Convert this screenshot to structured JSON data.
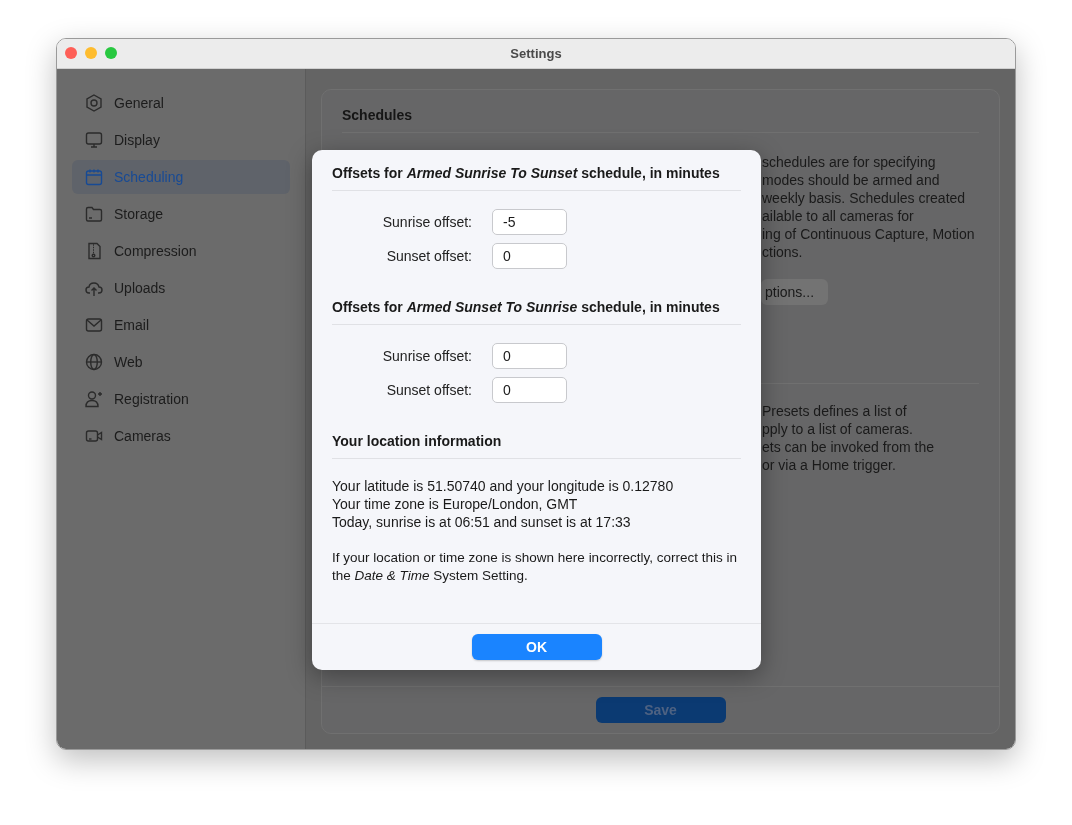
{
  "window": {
    "title": "Settings"
  },
  "sidebar": {
    "items": [
      {
        "label": "General",
        "selected": false
      },
      {
        "label": "Display",
        "selected": false
      },
      {
        "label": "Scheduling",
        "selected": true
      },
      {
        "label": "Storage",
        "selected": false
      },
      {
        "label": "Compression",
        "selected": false
      },
      {
        "label": "Uploads",
        "selected": false
      },
      {
        "label": "Email",
        "selected": false
      },
      {
        "label": "Web",
        "selected": false
      },
      {
        "label": "Registration",
        "selected": false
      },
      {
        "label": "Cameras",
        "selected": false
      }
    ]
  },
  "panel": {
    "title": "Schedules",
    "sections": [
      {
        "lines": [
          "schedules are for specifying",
          "modes should be armed and",
          "weekly basis. Schedules created",
          "ailable to all cameras for",
          "ing of Continuous Capture, Motion",
          "ctions."
        ],
        "button": "ptions..."
      },
      {
        "lines": [
          "Presets defines a list of",
          "pply to a list of cameras.",
          "ets can be invoked from the",
          "or via a Home trigger."
        ]
      }
    ],
    "save_button": "Save"
  },
  "dialog": {
    "groups": [
      {
        "heading": "Offsets for *Armed Sunrise To Sunset* schedule, in minutes",
        "fields": [
          {
            "label": "Sunrise offset:",
            "value": "-5"
          },
          {
            "label": "Sunset offset:",
            "value": "0"
          }
        ]
      },
      {
        "heading": "Offsets for *Armed Sunset To Sunrise* schedule, in minutes",
        "fields": [
          {
            "label": "Sunrise offset:",
            "value": "0"
          },
          {
            "label": "Sunset offset:",
            "value": "0"
          }
        ]
      }
    ],
    "location": {
      "heading": "Your location information",
      "lines": [
        "Your latitude is 51.50740 and your longitude is 0.12780",
        "Your time zone is Europe/London, GMT",
        "Today, sunrise is at 06:51 and sunset is at 17:33"
      ],
      "note": "If your location or time zone is shown here incorrectly, correct this in the *Date & Time* System Setting."
    },
    "ok_button": "OK"
  }
}
